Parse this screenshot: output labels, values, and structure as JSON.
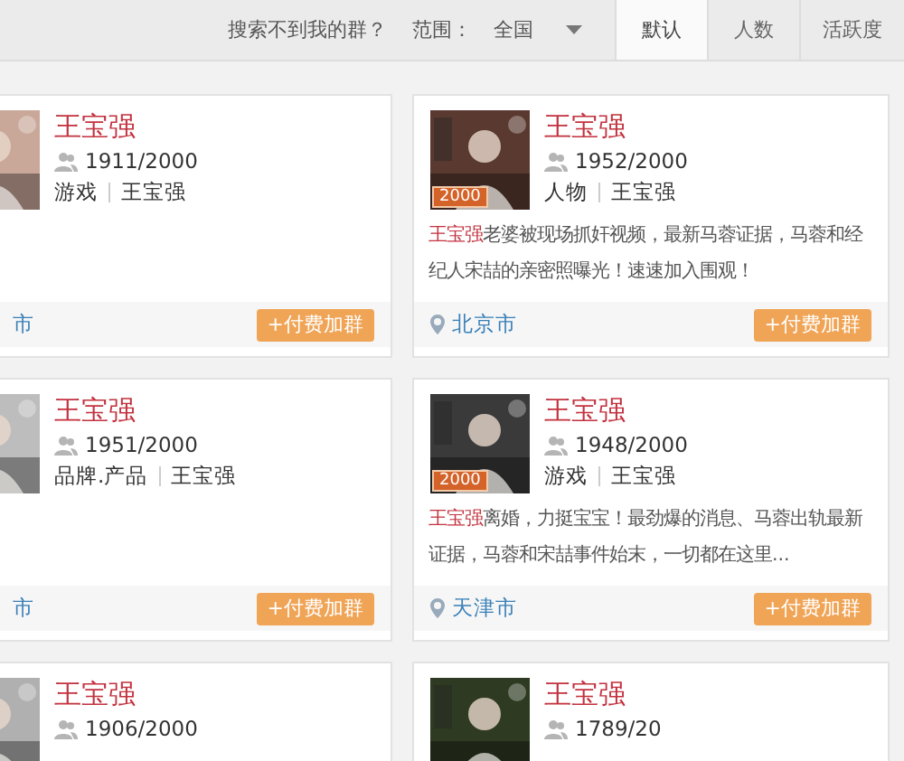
{
  "toolbar": {
    "hint": "搜索不到我的群？",
    "scope_label": "范围：",
    "scope_value": "全国",
    "tabs": [
      {
        "label": "默认",
        "selected": true
      },
      {
        "label": "人数",
        "selected": false
      },
      {
        "label": "活跃度",
        "selected": false
      }
    ]
  },
  "groups": [
    {
      "name": "王宝强",
      "members": "1911/2000",
      "tags": [
        "游戏",
        "王宝强"
      ],
      "location": "市",
      "join": "+付费加群"
    },
    {
      "name": "王宝强",
      "members": "1952/2000",
      "tags": [
        "人物",
        "王宝强"
      ],
      "badge": "2000",
      "description": {
        "highlight": "王宝强",
        "text": "老婆被现场抓奸视频，最新马蓉证据，马蓉和经纪人宋喆的亲密照曝光！速速加入围观！"
      },
      "location": "北京市",
      "join": "+付费加群"
    },
    {
      "name": "王宝强",
      "members": "1951/2000",
      "tags": [
        "品牌.产品",
        "王宝强"
      ],
      "location": "市",
      "join": "+付费加群"
    },
    {
      "name": "王宝强",
      "members": "1948/2000",
      "tags": [
        "游戏",
        "王宝强"
      ],
      "badge": "2000",
      "description": {
        "highlight": "王宝强",
        "text": "离婚，力挺宝宝！最劲爆的消息、马蓉出轨最新证据，马蓉和宋喆事件始末，一切都在这里..."
      },
      "location": "天津市",
      "join": "+付费加群"
    },
    {
      "name": "王宝强",
      "members": "1906/2000"
    },
    {
      "name": "王宝强",
      "members": "1789/20"
    }
  ]
}
